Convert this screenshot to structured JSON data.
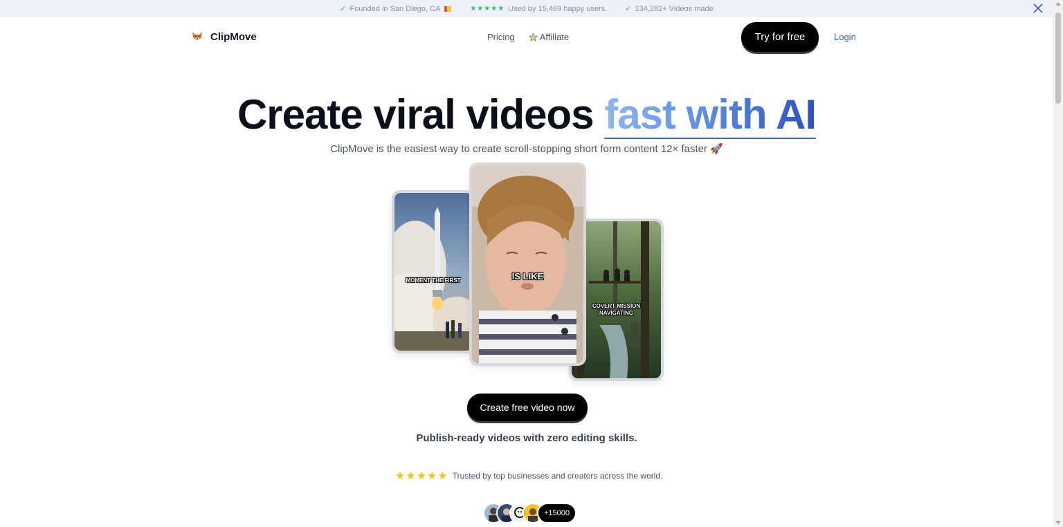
{
  "topbar": {
    "founded": "Founded in San Diego, CA",
    "stars": "★★★★★",
    "users": "Used by 15,469 happy users.",
    "videos": "134,282+ Videos made"
  },
  "nav": {
    "brand": "ClipMove",
    "pricing": "Pricing",
    "affiliate": "Affiliate",
    "try_button": "Try for free",
    "login": "Login"
  },
  "hero": {
    "headline_main": "Create viral videos ",
    "headline_accent": "fast with AI",
    "subhead": "ClipMove is the easiest way to create scroll-stopping short form content 12× faster 🚀"
  },
  "cards": [
    {
      "caption": "MOMENT THE FIRST"
    },
    {
      "caption": "IS LIKE"
    },
    {
      "caption": "COVERT MISSION NAVIGATING"
    }
  ],
  "cta": "Create free video now",
  "tagline": "Publish-ready videos with zero editing skills.",
  "trust": {
    "stars": "★★★★★",
    "text": "Trusted by top businesses and creators across the world."
  },
  "avatars": {
    "count": "+15000"
  },
  "colors": {
    "accent_start": "#8fb6f2",
    "accent_end": "#2d4fc4",
    "check_green": "#22c55e",
    "star_yellow": "#f5c518",
    "login_blue": "#3b5cc4"
  }
}
